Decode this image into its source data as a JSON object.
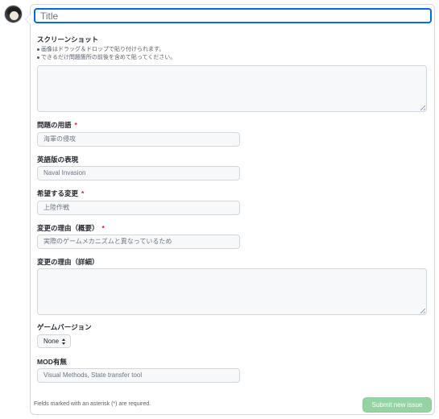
{
  "title_field": {
    "placeholder": "Title"
  },
  "screenshot": {
    "label": "スクリーンショット",
    "hints": [
      "画像はドラッグ＆ドロップで貼り付けられます。",
      "できるだけ問題箇所の前後を含めて貼ってください。"
    ]
  },
  "term": {
    "label": "問題の用語",
    "required_mark": "*",
    "placeholder": "海軍の侵攻"
  },
  "english_expression": {
    "label": "英語版の表現",
    "placeholder": "Naval Invasion"
  },
  "desired_change": {
    "label": "希望する変更",
    "required_mark": "*",
    "placeholder": "上陸作戦"
  },
  "reason_summary": {
    "label": "変更の理由（概要）",
    "required_mark": "*",
    "placeholder": "実際のゲームメカニズムと異なっているため"
  },
  "reason_detail": {
    "label": "変更の理由（詳細）"
  },
  "game_version": {
    "label": "ゲームバージョン",
    "selected": "None"
  },
  "mods": {
    "label": "MOD有無",
    "placeholder": "Visual Methods, State transfer tool"
  },
  "footer": {
    "required_note": "Fields marked with an asterisk (*) are required.",
    "submit_label": "Submit new issue"
  },
  "colors": {
    "accent": "#0969da",
    "required": "#cf222e",
    "submit_disabled": "#94d3a2"
  }
}
